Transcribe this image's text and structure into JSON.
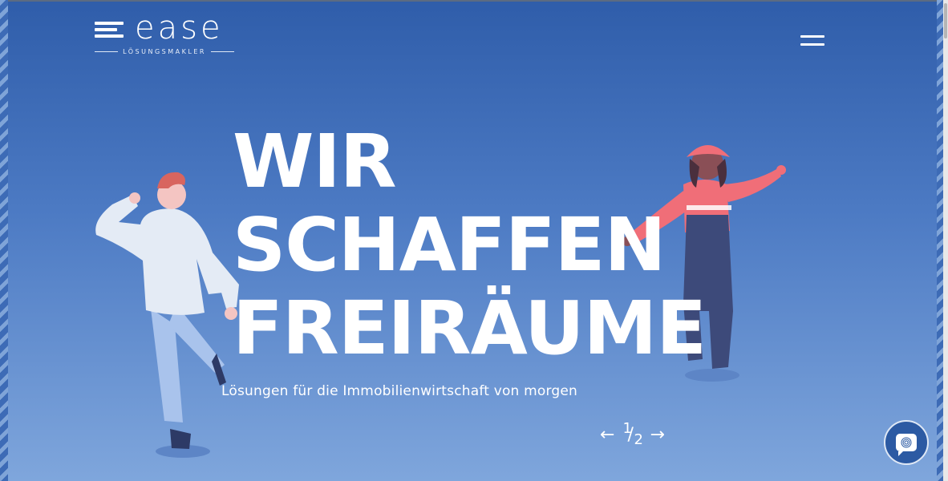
{
  "brand": {
    "name": "ease",
    "tagline": "LÖSUNGSMAKLER"
  },
  "hero": {
    "line1": "WIR",
    "line2": "SCHAFFEN",
    "line3": "FREIRÄUME",
    "subtitle": "Lösungen für die Immobilienwirtschaft von morgen"
  },
  "slider": {
    "prev_icon": "arrow-left-icon",
    "next_icon": "arrow-right-icon",
    "current": "1",
    "separator": "/",
    "total": "2"
  },
  "icons": {
    "menu": "hamburger-icon",
    "chat": "chat-icon",
    "fingerprint": "fingerprint-icon"
  },
  "colors": {
    "background_top": "#2f5daa",
    "background_bottom": "#7fa6dc",
    "text": "#ffffff",
    "accent": "#f06e78"
  }
}
